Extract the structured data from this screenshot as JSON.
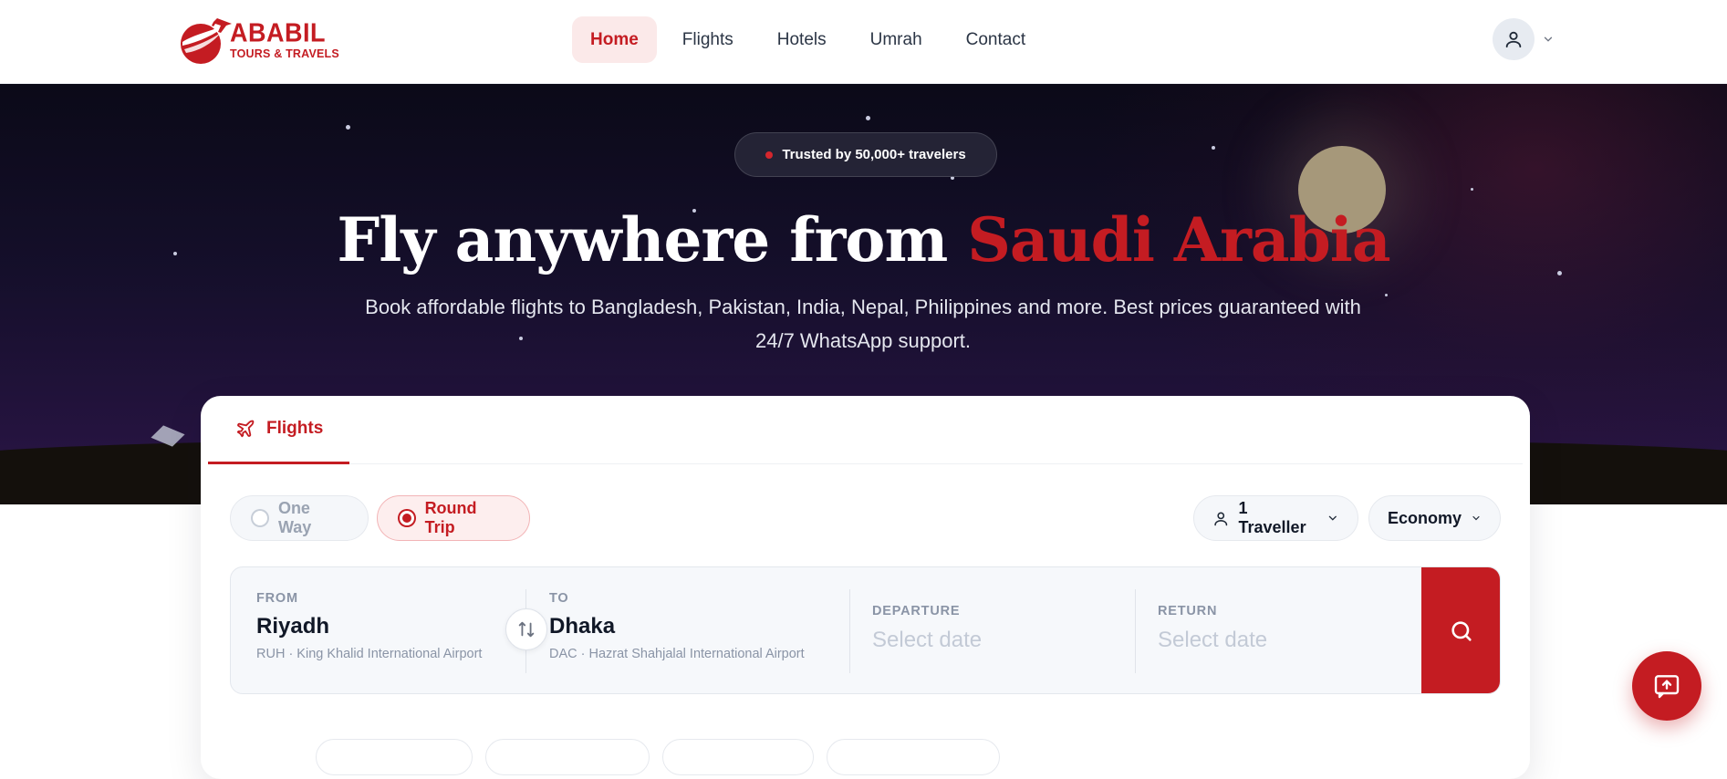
{
  "brand": {
    "name": "ABABIL",
    "tagline": "TOURS & TRAVELS"
  },
  "nav": {
    "items": [
      {
        "label": "Home",
        "active": true
      },
      {
        "label": "Flights",
        "active": false
      },
      {
        "label": "Hotels",
        "active": false
      },
      {
        "label": "Umrah",
        "active": false
      },
      {
        "label": "Contact",
        "active": false
      }
    ],
    "user_icon": "user-icon",
    "dropdown_icon": "chevron-down-icon"
  },
  "hero": {
    "badge": "Trusted by 50,000+ travelers",
    "headline_main": "Fly anywhere from ",
    "headline_accent": "Saudi Arabia",
    "subline": "Book affordable flights to Bangladesh, Pakistan, India, Nepal, Philippines and more. Best prices guaranteed with 24/7 WhatsApp support."
  },
  "search": {
    "tab": {
      "label": "Flights",
      "icon": "plane-icon"
    },
    "trip_types": [
      {
        "label": "One Way",
        "selected": false
      },
      {
        "label": "Round Trip",
        "selected": true
      }
    ],
    "travellers": "1 Traveller",
    "cabin_class": "Economy",
    "from": {
      "label": "FROM",
      "city": "Riyadh",
      "airport": "RUH · King Khalid International Airport"
    },
    "to": {
      "label": "TO",
      "city": "Dhaka",
      "airport": "DAC · Hazrat Shahjalal International Airport"
    },
    "departure": {
      "label": "DEPARTURE",
      "placeholder": "Select date"
    },
    "return": {
      "label": "RETURN",
      "placeholder": "Select date"
    },
    "swap_icon": "swap-icon",
    "search_icon": "search-icon"
  },
  "colors": {
    "brand_red": "#c41c22",
    "hero_top": "#0b0a18",
    "hero_bottom": "#2b1547",
    "moon": "#a6987a"
  },
  "chat_icon": "chat-support-icon"
}
